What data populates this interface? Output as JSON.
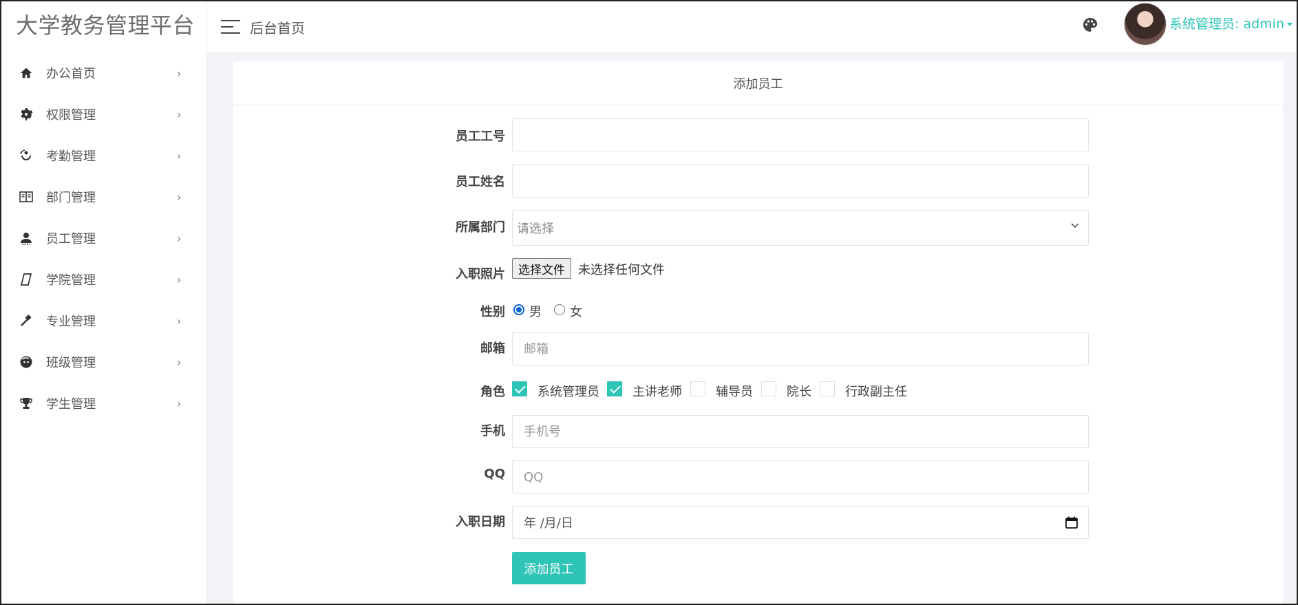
{
  "app": {
    "title": "大学教务管理平台"
  },
  "header": {
    "home_link": "后台首页",
    "user_label": "系统管理员: admin",
    "accent_color": "#2ec4b6"
  },
  "sidebar": {
    "items": [
      {
        "label": "办公首页",
        "icon": "home-icon"
      },
      {
        "label": "权限管理",
        "icon": "gear-icon"
      },
      {
        "label": "考勤管理",
        "icon": "attendance-icon"
      },
      {
        "label": "部门管理",
        "icon": "department-icon"
      },
      {
        "label": "员工管理",
        "icon": "user-icon"
      },
      {
        "label": "学院管理",
        "icon": "college-icon"
      },
      {
        "label": "专业管理",
        "icon": "hammer-icon"
      },
      {
        "label": "班级管理",
        "icon": "class-icon"
      },
      {
        "label": "学生管理",
        "icon": "trophy-icon"
      }
    ]
  },
  "form": {
    "title": "添加员工",
    "employee_no": {
      "label": "员工工号",
      "value": "",
      "placeholder": ""
    },
    "employee_name": {
      "label": "员工姓名",
      "value": "",
      "placeholder": ""
    },
    "department": {
      "label": "所属部门",
      "selected": "请选择"
    },
    "photo": {
      "label": "入职照片",
      "button": "选择文件",
      "status": "未选择任何文件"
    },
    "gender": {
      "label": "性别",
      "options": [
        "男",
        "女"
      ],
      "selected": "男"
    },
    "email": {
      "label": "邮箱",
      "value": "",
      "placeholder": "邮箱"
    },
    "role": {
      "label": "角色",
      "options": [
        {
          "label": "系统管理员",
          "checked": true
        },
        {
          "label": "主讲老师",
          "checked": true
        },
        {
          "label": "辅导员",
          "checked": false
        },
        {
          "label": "院长",
          "checked": false
        },
        {
          "label": "行政副主任",
          "checked": false
        }
      ]
    },
    "phone": {
      "label": "手机",
      "value": "",
      "placeholder": "手机号"
    },
    "qq": {
      "label": "QQ",
      "value": "",
      "placeholder": "QQ"
    },
    "hire_date": {
      "label": "入职日期",
      "display": "年 /月/日"
    },
    "submit_label": "添加员工"
  }
}
